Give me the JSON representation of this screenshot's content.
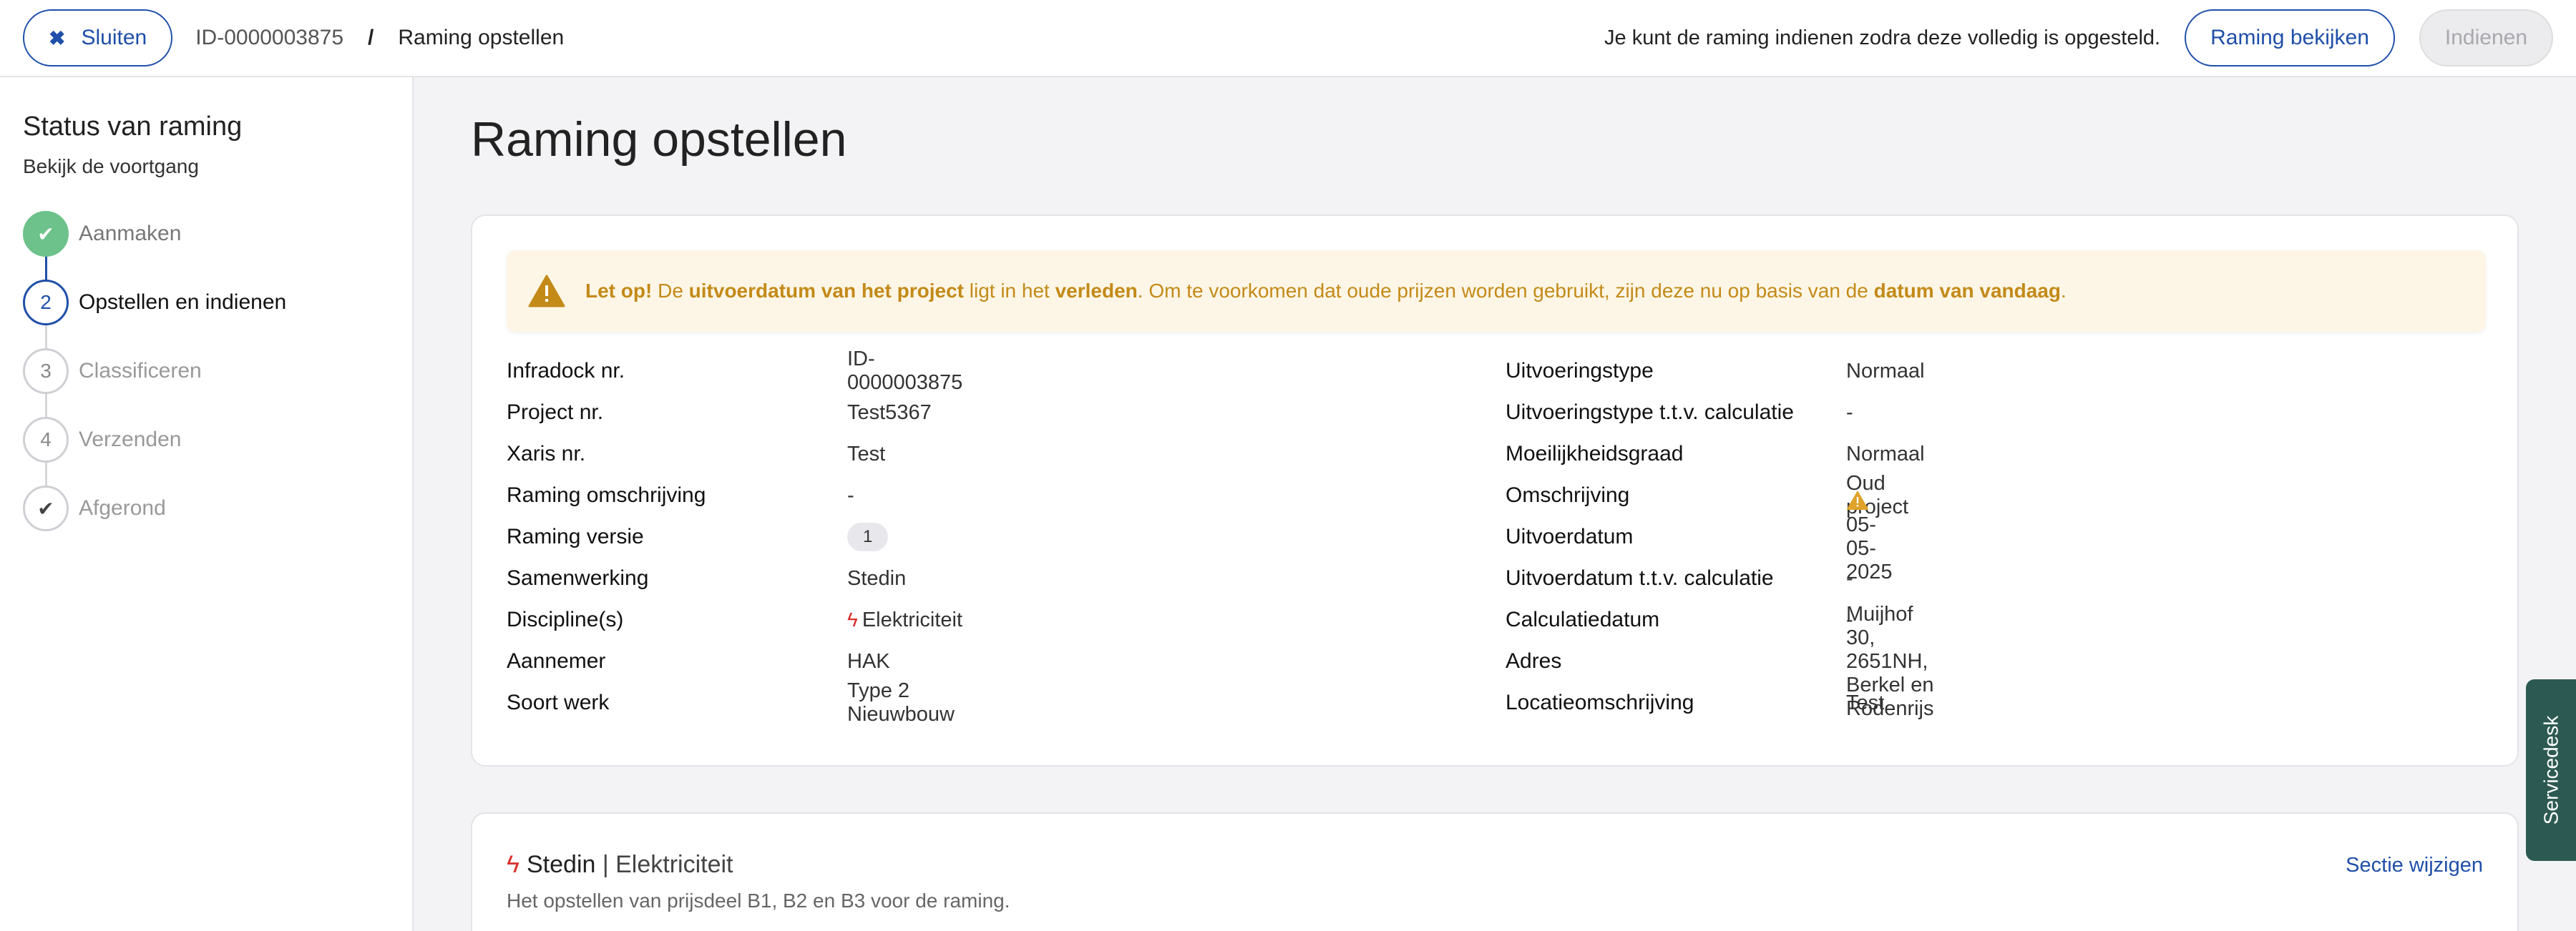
{
  "topbar": {
    "close_label": "Sluiten",
    "breadcrumb_id": "ID-0000003875",
    "breadcrumb_sep": "/",
    "breadcrumb_current": "Raming opstellen",
    "notice": "Je kunt de raming indienen zodra deze volledig is opgesteld.",
    "view_label": "Raming bekijken",
    "submit_label": "Indienen"
  },
  "sidebar": {
    "title": "Status van raming",
    "subtitle": "Bekijk de voortgang",
    "steps": [
      {
        "number": "✔",
        "label": "Aanmaken",
        "state": "done"
      },
      {
        "number": "2",
        "label": "Opstellen en indienen",
        "state": "active"
      },
      {
        "number": "3",
        "label": "Classificeren",
        "state": "todo"
      },
      {
        "number": "4",
        "label": "Verzenden",
        "state": "todo"
      },
      {
        "number": "✔",
        "label": "Afgerond",
        "state": "todo"
      }
    ]
  },
  "main": {
    "title": "Raming opstellen",
    "alert": {
      "p1": "Let op!",
      "p2": " De ",
      "p3": "uitvoerdatum van het project",
      "p4": " ligt in het ",
      "p5": "verleden",
      "p6": ". Om te voorkomen dat oude prijzen worden gebruikt, zijn deze nu op basis van de ",
      "p7": "datum van vandaag",
      "p8": "."
    },
    "left_fields": [
      {
        "label": "Infradock nr.",
        "value": "ID-0000003875"
      },
      {
        "label": "Project nr.",
        "value": "Test5367"
      },
      {
        "label": "Xaris nr.",
        "value": "Test"
      },
      {
        "label": "Raming omschrijving",
        "value": "-"
      },
      {
        "label": "Raming versie",
        "value": "1"
      },
      {
        "label": "Samenwerking",
        "value": "Stedin"
      },
      {
        "label": "Discipline(s)",
        "value": "Elektriciteit"
      },
      {
        "label": "Aannemer",
        "value": "HAK"
      },
      {
        "label": "Soort werk",
        "value": "Type 2 Nieuwbouw"
      }
    ],
    "right_fields": [
      {
        "label": "Uitvoeringstype",
        "value": "Normaal"
      },
      {
        "label": "Uitvoeringstype t.t.v. calculatie",
        "value": "-"
      },
      {
        "label": "Moeilijkheidsgraad",
        "value": "Normaal"
      },
      {
        "label": "Omschrijving",
        "value": "Oud project"
      },
      {
        "label": "Uitvoerdatum",
        "value": "05-05-2025"
      },
      {
        "label": "Uitvoerdatum t.t.v. calculatie",
        "value": "-"
      },
      {
        "label": "Calculatiedatum",
        "value": "-"
      },
      {
        "label": "Adres",
        "value": "Muijhof 30, 2651NH, Berkel en Rodenrijs"
      },
      {
        "label": "Locatieomschrijving",
        "value": "Test"
      }
    ],
    "section": {
      "title_strong": "Stedin",
      "title_rest": " | Elektriciteit",
      "subtitle": "Het opstellen van prijsdeel B1, B2 en B3 voor de raming.",
      "edit_label": "Sectie wijzigen"
    }
  },
  "servicedesk_label": "Servicedesk",
  "colors": {
    "primary": "#1f4fa8",
    "done": "#6cc28a",
    "warning": "#c38a18",
    "bolt": "#d9302b",
    "servicedesk": "#2c5a52"
  },
  "icons": {
    "close": "close-icon",
    "warning": "warning-icon",
    "bolt": "lightning-icon",
    "check": "check-icon"
  }
}
